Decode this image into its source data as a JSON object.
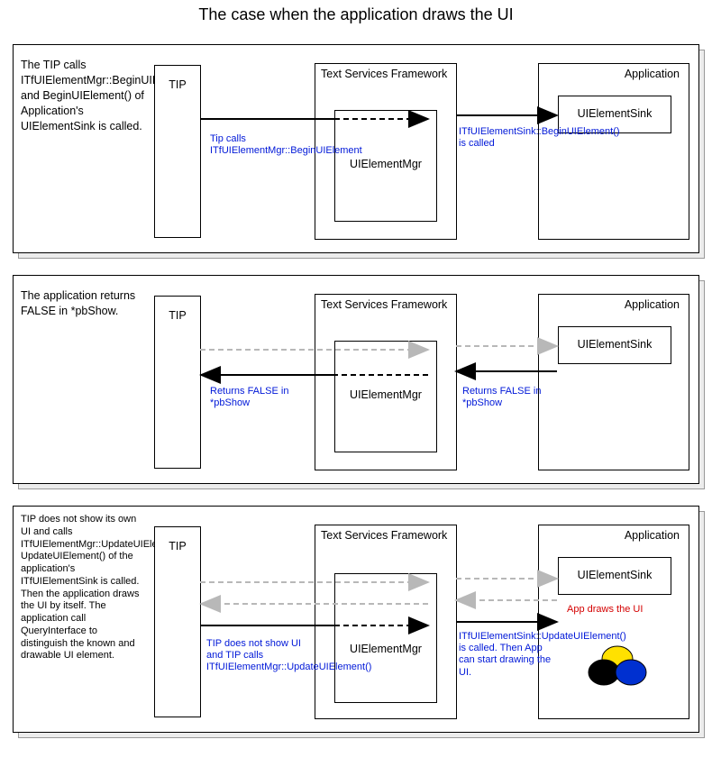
{
  "title": "The case when the application draws the UI",
  "boxes": {
    "tip": "TIP",
    "tsf": "Text Services Framework",
    "mgr": "UIElementMgr",
    "app": "Application",
    "sink": "UIElementSink"
  },
  "panels": [
    {
      "desc": "The TIP calls ITfUIElementMgr::BeginUIElement() and BeginUIElement() of Application's UIElementSink is called.",
      "note_left": "Tip calls ITfUIElementMgr::BeginUIElement",
      "note_right": "ITfUIElementSink::BeginUIElement() is called"
    },
    {
      "desc": "The application returns FALSE in *pbShow.",
      "note_left": "Returns FALSE in *pbShow",
      "note_right": "Returns FALSE in *pbShow"
    },
    {
      "desc": "TIP does not show its own UI and calls ITfUIElementMgr::UpdateUIElement(). UpdateUIElement() of the application's ITfUIElementSink is called. Then the application draws the UI by itself. The application call QueryInterface to distinguish the known and drawable UI element.",
      "note_left": "TIP does not show UI and TIP calls ITfUIElementMgr::UpdateUIElement()",
      "note_right": "ITfUIElementSink::UpdateUIElement() is called. Then App can start drawing the UI.",
      "red": "App draws the UI"
    }
  ]
}
